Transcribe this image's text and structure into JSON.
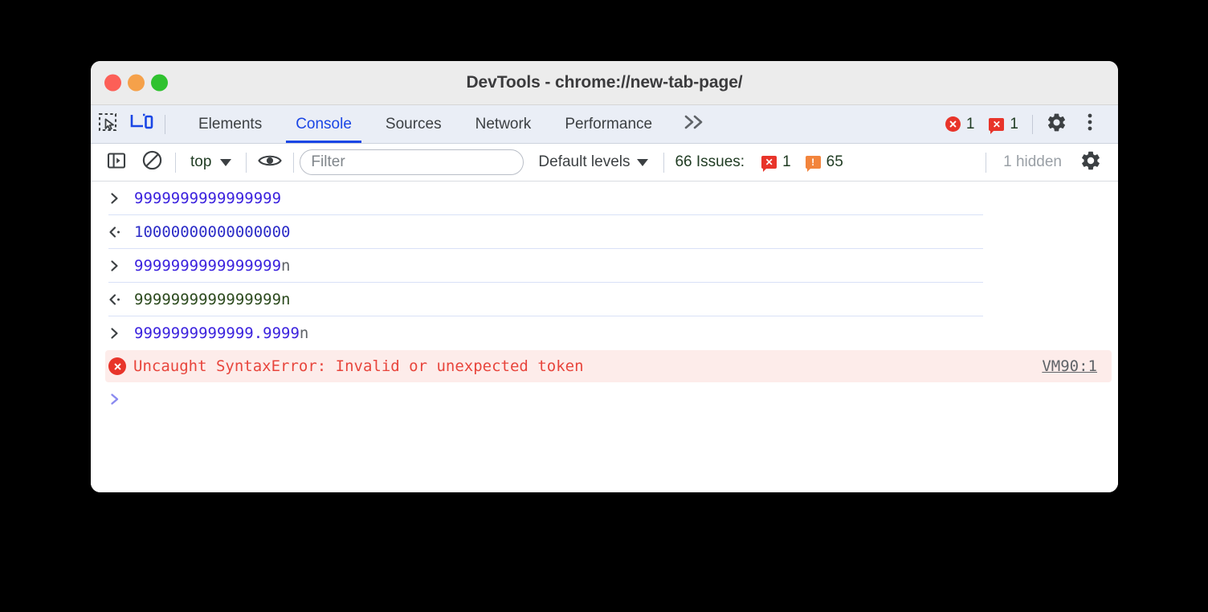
{
  "window": {
    "title": "DevTools - chrome://new-tab-page/",
    "traffic_lights": [
      {
        "name": "close",
        "color": "#fc5f57"
      },
      {
        "name": "minimize",
        "color": "#f5a14a"
      },
      {
        "name": "maximize",
        "color": "#2fc22f"
      }
    ]
  },
  "tabbar": {
    "inspect_icon": "inspect-element-icon",
    "device_icon": "device-toolbar-icon",
    "tabs": [
      {
        "label": "Elements",
        "active": false
      },
      {
        "label": "Console",
        "active": true
      },
      {
        "label": "Sources",
        "active": false
      },
      {
        "label": "Network",
        "active": false
      },
      {
        "label": "Performance",
        "active": false
      }
    ],
    "overflow_label": "»",
    "errors": {
      "icon": "error-circle-icon",
      "count": "1"
    },
    "messages": {
      "icon": "message-error-icon",
      "count": "1"
    },
    "settings_icon": "gear-icon",
    "more_icon": "three-dot-menu-icon"
  },
  "console_toolbar": {
    "sidebar_toggle_icon": "show-console-sidebar-icon",
    "clear_icon": "clear-console-icon",
    "context": {
      "label": "top"
    },
    "eye_icon": "live-expression-eye-icon",
    "filter": {
      "placeholder": "Filter",
      "value": ""
    },
    "levels": {
      "label": "Default levels"
    },
    "issues": {
      "label": "66 Issues:",
      "error_count": "1",
      "warning_count": "65"
    },
    "hidden_label": "1 hidden",
    "settings_icon": "console-settings-gear-icon"
  },
  "console_messages": [
    {
      "kind": "input",
      "gutter": "input-chevron-icon",
      "text": "9999999999999999",
      "suffix": "",
      "style": "num-input"
    },
    {
      "kind": "result",
      "gutter": "result-chevron-icon",
      "text": "10000000000000000",
      "suffix": "",
      "style": "num-result"
    },
    {
      "kind": "input",
      "gutter": "input-chevron-icon",
      "text": "9999999999999999",
      "suffix": "n",
      "style": "num-input"
    },
    {
      "kind": "result",
      "gutter": "result-chevron-icon",
      "text": "9999999999999999n",
      "suffix": "",
      "style": "bigint"
    },
    {
      "kind": "input",
      "gutter": "input-chevron-icon",
      "text": "9999999999999.9999",
      "suffix": "n",
      "style": "num-input"
    }
  ],
  "error_message": {
    "icon": "error-circle-icon",
    "text": "Uncaught SyntaxError: Invalid or unexpected token",
    "source_link": "VM90:1"
  },
  "prompt": {
    "icon": "prompt-chevron-icon"
  },
  "colors": {
    "accent_blue": "#1a46e5",
    "error_red": "#e8342a",
    "warning_orange": "#f2843c",
    "bigint_green": "#2c4a1e",
    "number_blue": "#2b2bc7",
    "error_bg": "#fdecea"
  }
}
